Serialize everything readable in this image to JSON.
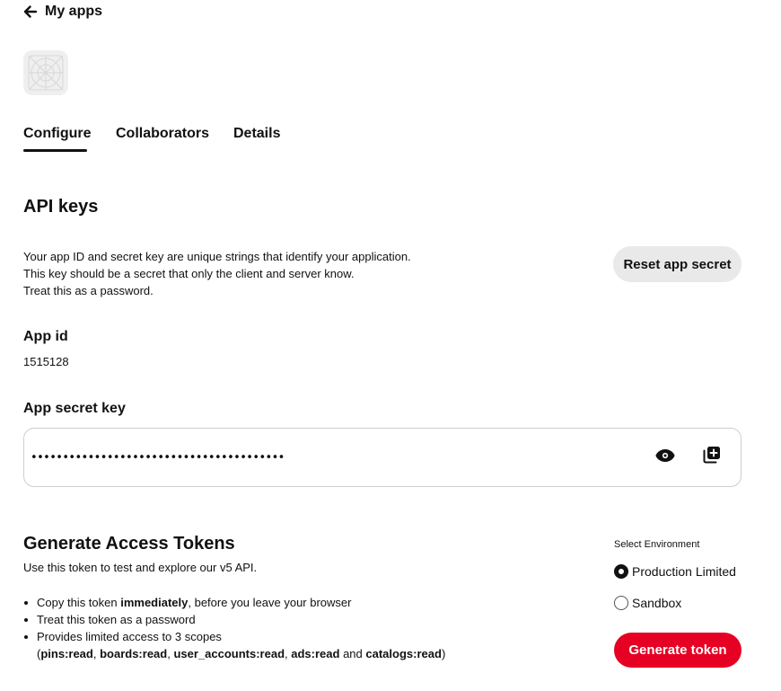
{
  "nav": {
    "back_label": "My apps",
    "back_icon": "arrow-left-icon"
  },
  "app": {
    "icon": "app-placeholder-icon"
  },
  "tabs": [
    {
      "label": "Configure",
      "active": true
    },
    {
      "label": "Collaborators",
      "active": false
    },
    {
      "label": "Details",
      "active": false
    }
  ],
  "api_keys": {
    "title": "API keys",
    "description_lines": [
      "Your app ID and secret key are unique strings that identify your application.",
      "This key should be a secret that only the client and server know.",
      "Treat this as a password."
    ],
    "reset_label": "Reset app secret",
    "app_id_label": "App id",
    "app_id_value": "1515128",
    "secret_label": "App secret key",
    "secret_masked": "••••••••••••••••••••••••••••••••••••••••",
    "show_icon": "eye-icon",
    "copy_icon": "copy-icon"
  },
  "tokens": {
    "title": "Generate Access Tokens",
    "subtitle": "Use this token to test and explore our v5 API.",
    "bullet1_pre": "Copy this token ",
    "bullet1_bold": "immediately",
    "bullet1_post": ", before you leave your browser",
    "bullet2": "Treat this token as a password",
    "bullet3": "Provides limited access to 3 scopes",
    "scopes_open": "(",
    "scopes": [
      "pins:read",
      "boards:read",
      "user_accounts:read",
      "ads:read",
      "catalogs:read"
    ],
    "sep": ", ",
    "and": " and ",
    "scopes_close": ")",
    "env_label": "Select Environment",
    "env_options": [
      {
        "label": "Production Limited",
        "selected": true
      },
      {
        "label": "Sandbox",
        "selected": false
      }
    ],
    "generate_label": "Generate token"
  },
  "colors": {
    "accent": "#e60023",
    "secondary_button": "#e9e9e9",
    "text": "#111111"
  }
}
